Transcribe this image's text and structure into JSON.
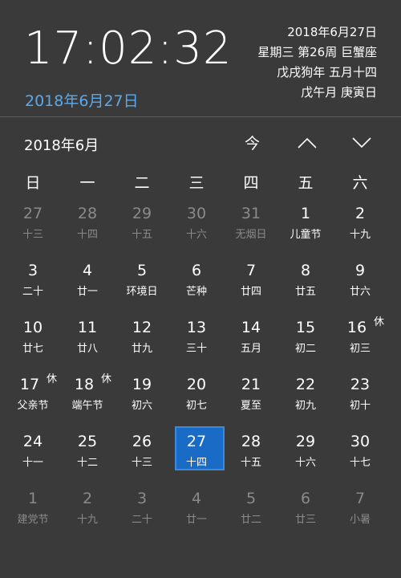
{
  "clock": {
    "time": "17:02:32",
    "date": "2018年6月27日"
  },
  "info": {
    "line1": "2018年6月27日",
    "line2": "星期三 第26周 巨蟹座",
    "line3": "戊戌狗年 五月十四",
    "line4": "戊午月 庚寅日"
  },
  "calendar": {
    "month_label": "2018年6月",
    "today_label": "今",
    "weekdays": [
      "日",
      "一",
      "二",
      "三",
      "四",
      "五",
      "六"
    ],
    "days": [
      {
        "n": "27",
        "s": "十三",
        "other": true
      },
      {
        "n": "28",
        "s": "十四",
        "other": true
      },
      {
        "n": "29",
        "s": "十五",
        "other": true
      },
      {
        "n": "30",
        "s": "十六",
        "other": true
      },
      {
        "n": "31",
        "s": "无烟日",
        "other": true
      },
      {
        "n": "1",
        "s": "儿童节"
      },
      {
        "n": "2",
        "s": "十九"
      },
      {
        "n": "3",
        "s": "二十"
      },
      {
        "n": "4",
        "s": "廿一"
      },
      {
        "n": "5",
        "s": "环境日"
      },
      {
        "n": "6",
        "s": "芒种"
      },
      {
        "n": "7",
        "s": "廿四"
      },
      {
        "n": "8",
        "s": "廿五"
      },
      {
        "n": "9",
        "s": "廿六"
      },
      {
        "n": "10",
        "s": "廿七"
      },
      {
        "n": "11",
        "s": "廿八"
      },
      {
        "n": "12",
        "s": "廿九"
      },
      {
        "n": "13",
        "s": "三十"
      },
      {
        "n": "14",
        "s": "五月"
      },
      {
        "n": "15",
        "s": "初二"
      },
      {
        "n": "16",
        "s": "初三",
        "rest": "休"
      },
      {
        "n": "17",
        "s": "父亲节",
        "rest": "休"
      },
      {
        "n": "18",
        "s": "端午节",
        "rest": "休"
      },
      {
        "n": "19",
        "s": "初六"
      },
      {
        "n": "20",
        "s": "初七"
      },
      {
        "n": "21",
        "s": "夏至"
      },
      {
        "n": "22",
        "s": "初九"
      },
      {
        "n": "23",
        "s": "初十"
      },
      {
        "n": "24",
        "s": "十一"
      },
      {
        "n": "25",
        "s": "十二"
      },
      {
        "n": "26",
        "s": "十三"
      },
      {
        "n": "27",
        "s": "十四",
        "selected": true
      },
      {
        "n": "28",
        "s": "十五"
      },
      {
        "n": "29",
        "s": "十六"
      },
      {
        "n": "30",
        "s": "十七"
      },
      {
        "n": "1",
        "s": "建党节",
        "other": true
      },
      {
        "n": "2",
        "s": "十九",
        "other": true
      },
      {
        "n": "3",
        "s": "二十",
        "other": true
      },
      {
        "n": "4",
        "s": "廿一",
        "other": true
      },
      {
        "n": "5",
        "s": "廿二",
        "other": true
      },
      {
        "n": "6",
        "s": "廿三",
        "other": true
      },
      {
        "n": "7",
        "s": "小暑",
        "other": true
      }
    ]
  },
  "colors": {
    "background": "#3a3a3a",
    "accent": "#5aa9ea",
    "selected": "#1a6bc6",
    "dimmed": "#8a8a8a"
  }
}
